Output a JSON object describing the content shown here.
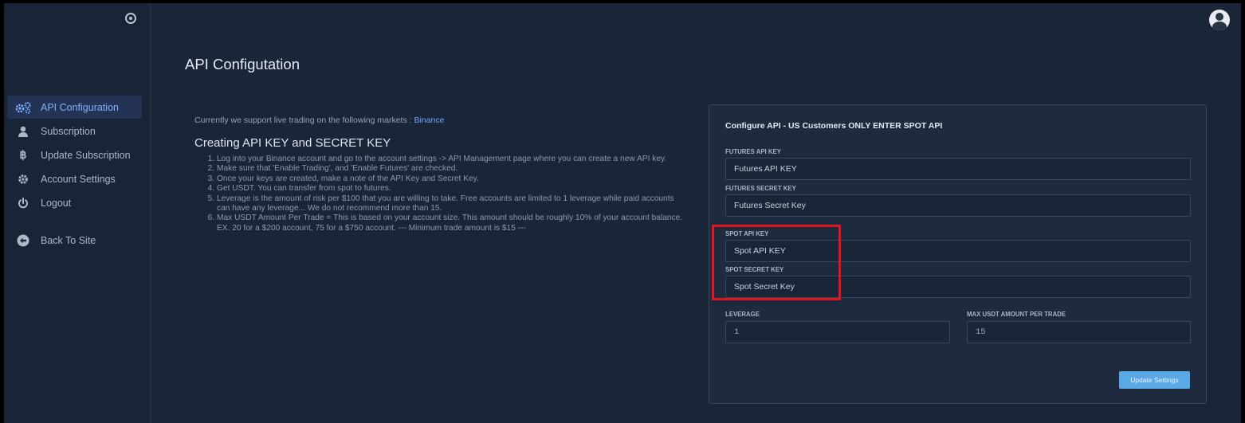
{
  "colors": {
    "background": "#1b2538",
    "accent": "#6fa8ff",
    "highlight": "#e3141b",
    "button": "#5aa8e6"
  },
  "sidebar": {
    "toggle_icon": "radio-circle-icon",
    "items": [
      {
        "label": "API Configuration",
        "icon": "gears-icon",
        "active": true
      },
      {
        "label": "Subscription",
        "icon": "user-icon"
      },
      {
        "label": "Update Subscription",
        "icon": "bitcoin-icon"
      },
      {
        "label": "Account Settings",
        "icon": "gear-icon"
      },
      {
        "label": "Logout",
        "icon": "power-icon"
      },
      {
        "label": "Back To Site",
        "icon": "arrow-left-circle-icon"
      }
    ]
  },
  "header": {
    "avatar_icon": "user-avatar-icon"
  },
  "page": {
    "title": "API Configutation"
  },
  "info": {
    "support_prefix": "Currently we support live trading on the following markets : ",
    "market": "Binance",
    "heading": "Creating API KEY and SECRET KEY",
    "steps": [
      "Log into your Binance account and go to the account settings -> API Management page where you can create a new API key.",
      "Make sure that 'Enable Trading', and 'Enable Futures' are checked.",
      "Once your keys are created, make a note of the API Key and Secret Key.",
      "Get USDT. You can transfer from spot to futures.",
      "Leverage is the amount of risk per $100 that you are willing to take. Free accounts are limited to 1 leverage while paid accounts can have any leverage... We do not recommend more than 15.",
      "Max USDT Amount Per Trade = This is based on your account size. This amount should be roughly 10% of your account balance. EX. 20 for a $200 account, 75 for a $750 account. --- Minimum trade amount is $15 ---"
    ]
  },
  "form": {
    "title": "Configure API - US Customers ONLY ENTER SPOT API",
    "futures_api_key": {
      "label": "FUTURES API KEY",
      "placeholder": "Futures API KEY"
    },
    "futures_secret_key": {
      "label": "FUTURES SECRET KEY",
      "placeholder": "Futures Secret Key"
    },
    "spot_api_key": {
      "label": "SPOT API KEY",
      "placeholder": "Spot API KEY"
    },
    "spot_secret_key": {
      "label": "SPOT SECRET KEY",
      "placeholder": "Spot Secret Key"
    },
    "leverage": {
      "label": "LEVERAGE",
      "value": "1"
    },
    "max_usdt": {
      "label": "MAX USDT AMOUNT PER TRADE",
      "value": "15"
    },
    "submit_label": "Update Settings"
  }
}
